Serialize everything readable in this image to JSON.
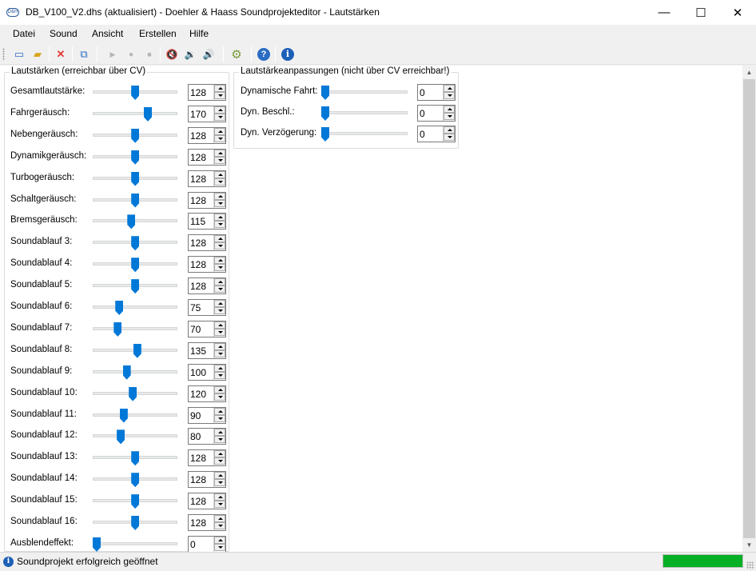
{
  "window": {
    "title": "DB_V100_V2.dhs (aktualisiert) - Doehler & Haass Soundprojekteditor - Lautstärken",
    "app_icon_text": "D&H",
    "minimize_glyph": "—",
    "maximize_glyph": "☐",
    "close_glyph": "✕"
  },
  "menu": [
    "Datei",
    "Sound",
    "Ansicht",
    "Erstellen",
    "Hilfe"
  ],
  "toolbar": {
    "icons": [
      "new-file-icon",
      "open-folder-icon",
      "delete-icon",
      "copy-to-device-icon",
      "play-icon",
      "record-icon",
      "stop-icon",
      "speaker-muted-icon",
      "speaker-low-icon",
      "speaker-high-icon",
      "settings-gear-icon",
      "help-icon",
      "info-icon"
    ],
    "glyphs": {
      "new": "▭",
      "open": "▰",
      "delete": "✕",
      "copy": "⧉",
      "play": "▶",
      "record": "●",
      "stop": "■",
      "mute": "🔇",
      "low": "🔉",
      "high": "🔊",
      "settings": "⚙",
      "help": "?",
      "info": "i"
    },
    "colors": {
      "delete": "#e53935",
      "help": "#2b6cc4",
      "info": "#1c5fb8",
      "disabled": "#b5b5b5",
      "gear": "#7a9a3a"
    }
  },
  "volumes_group": {
    "title": "Lautstärken (erreichbar über CV)",
    "max": 255,
    "rows": [
      {
        "label": "Gesamtlautstärke:",
        "value": "128",
        "level": 128
      },
      {
        "label": "Fahrgeräusch:",
        "value": "170",
        "level": 170
      },
      {
        "label": "Nebengeräusch:",
        "value": "128",
        "level": 128
      },
      {
        "label": "Dynamikgeräusch:",
        "value": "128",
        "level": 128
      },
      {
        "label": "Turbogeräusch:",
        "value": "128",
        "level": 128
      },
      {
        "label": "Schaltgeräusch:",
        "value": "128",
        "level": 128
      },
      {
        "label": "Bremsgeräusch:",
        "value": "115",
        "level": 115
      },
      {
        "label": "Soundablauf 3:",
        "value": "128",
        "level": 128
      },
      {
        "label": "Soundablauf 4:",
        "value": "128",
        "level": 128
      },
      {
        "label": "Soundablauf 5:",
        "value": "128",
        "level": 128
      },
      {
        "label": "Soundablauf 6:",
        "value": "75",
        "level": 75
      },
      {
        "label": "Soundablauf 7:",
        "value": "70",
        "level": 70
      },
      {
        "label": "Soundablauf 8:",
        "value": "135",
        "level": 135
      },
      {
        "label": "Soundablauf 9:",
        "value": "100",
        "level": 100
      },
      {
        "label": "Soundablauf 10:",
        "value": "120",
        "level": 120
      },
      {
        "label": "Soundablauf 11:",
        "value": "90",
        "level": 90
      },
      {
        "label": "Soundablauf 12:",
        "value": "80",
        "level": 80
      },
      {
        "label": "Soundablauf 13:",
        "value": "128",
        "level": 128
      },
      {
        "label": "Soundablauf 14:",
        "value": "128",
        "level": 128
      },
      {
        "label": "Soundablauf 15:",
        "value": "128",
        "level": 128
      },
      {
        "label": "Soundablauf 16:",
        "value": "128",
        "level": 128
      },
      {
        "label": "Ausblendeffekt:",
        "value": "0",
        "level": 0
      }
    ]
  },
  "adjust_group": {
    "title": "Lautstärkeanpassungen (nicht über CV erreichbar!)",
    "max": 255,
    "rows": [
      {
        "label": "Dynamische Fahrt:",
        "value": "0",
        "level": 0
      },
      {
        "label": "Dyn. Beschl.:",
        "value": "0",
        "level": 0
      },
      {
        "label": "Dyn. Verzögerung:",
        "value": "0",
        "level": 0
      }
    ]
  },
  "status": {
    "info_glyph": "i",
    "text": "Soundprojekt erfolgreich geöffnet",
    "progress": 1.0,
    "progress_color": "#06b025"
  },
  "colors": {
    "accent": "#0078d7"
  }
}
